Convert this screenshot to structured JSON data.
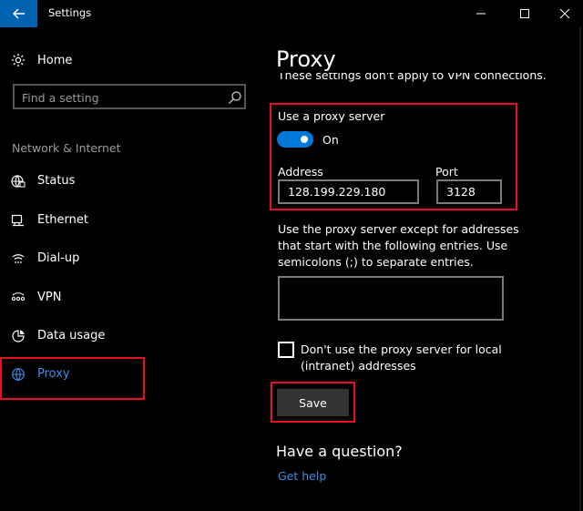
{
  "window": {
    "title": "Settings",
    "back_icon": "arrow-left-icon",
    "minimize_icon": "minimize-icon",
    "maximize_icon": "maximize-icon",
    "close_icon": "close-icon"
  },
  "sidebar": {
    "home_label": "Home",
    "search_placeholder": "Find a setting",
    "section": "Network & Internet",
    "items": [
      {
        "label": "Status",
        "icon": "globe-status-icon"
      },
      {
        "label": "Ethernet",
        "icon": "ethernet-icon"
      },
      {
        "label": "Dial-up",
        "icon": "dialup-icon"
      },
      {
        "label": "VPN",
        "icon": "vpn-icon"
      },
      {
        "label": "Data usage",
        "icon": "data-usage-icon"
      },
      {
        "label": "Proxy",
        "icon": "globe-icon"
      }
    ],
    "active_item": "Proxy"
  },
  "main": {
    "title": "Proxy",
    "vpn_note": "These settings don't apply to VPN connections.",
    "use_proxy_label": "Use a proxy server",
    "toggle_state": "On",
    "address_label": "Address",
    "address_value": "128.199.229.180",
    "port_label": "Port",
    "port_value": "3128",
    "exceptions_desc": "Use the proxy server except for addresses that start with the following entries. Use semicolons (;) to separate entries.",
    "exceptions_value": "",
    "local_checkbox_label": "Don't use the proxy server for local (intranet) addresses",
    "local_checkbox_checked": false,
    "save_label": "Save",
    "question": "Have a question?",
    "get_help": "Get help"
  },
  "colors": {
    "accent": "#0078d7",
    "link": "#3a8ee6",
    "highlight": "#e81123",
    "background": "#000000"
  }
}
